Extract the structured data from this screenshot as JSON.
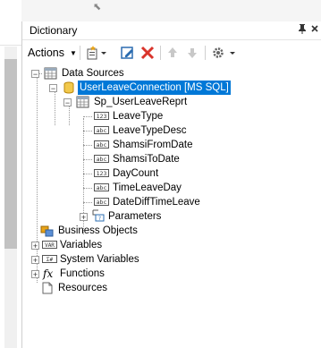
{
  "dictionary": {
    "title": "Dictionary",
    "header_icons": [
      "pin-icon",
      "close-icon"
    ]
  },
  "toolbar": {
    "actions_label": "Actions",
    "buttons": [
      "new-item-icon",
      "edit-icon",
      "delete-icon",
      "move-up-icon",
      "move-down-icon",
      "settings-icon"
    ]
  },
  "tree": {
    "data_sources": "Data Sources",
    "connection": "UserLeaveConnection [MS SQL]",
    "datasource": "Sp_UserLeaveReprt",
    "fields": [
      {
        "name": "LeaveType",
        "kind": "123"
      },
      {
        "name": "LeaveTypeDesc",
        "kind": "abc"
      },
      {
        "name": "ShamsiFromDate",
        "kind": "abc"
      },
      {
        "name": "ShamsiToDate",
        "kind": "abc"
      },
      {
        "name": "DayCount",
        "kind": "123"
      },
      {
        "name": "TimeLeaveDay",
        "kind": "abc"
      },
      {
        "name": "DateDiffTimeLeave",
        "kind": "abc"
      }
    ],
    "parameters": "Parameters",
    "business_objects": "Business Objects",
    "variables": "Variables",
    "system_variables": "System Variables",
    "functions": "Functions",
    "resources": "Resources"
  },
  "colors": {
    "selection": "#0078d7",
    "delete": "#d9342b",
    "edit": "#2b6cb0"
  }
}
